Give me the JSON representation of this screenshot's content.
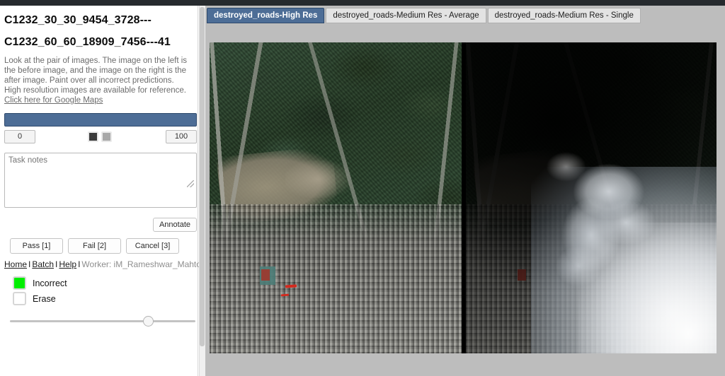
{
  "sidebar": {
    "title_line1": "C1232_30_30_9454_3728---",
    "title_line2": "C1232_60_60_18909_7456---41",
    "instructions": "Look at the pair of images. The image on the left is the before image, and the image on the right is the after image. Paint over all incorrect predictions. High resolution images are available for reference. ",
    "instructions_link": "Click here for Google Maps",
    "slider": {
      "min_label": "0",
      "max_label": "100"
    },
    "swatches": {
      "dark": "#3b3b3b",
      "light": "#a8a8a8"
    },
    "notes": {
      "placeholder": "Task notes",
      "value": ""
    },
    "annotate_label": "Annotate",
    "verdicts": [
      {
        "label": "Pass [1]"
      },
      {
        "label": "Fail [2]"
      },
      {
        "label": "Cancel [3]"
      }
    ],
    "links": {
      "home": "Home",
      "batch": "Batch",
      "help": "Help",
      "separator": "I",
      "worker": "Worker: iM_Rameshwar_Mahto"
    },
    "legend": [
      {
        "label": "Incorrect",
        "color": "#00ee00"
      },
      {
        "label": "Erase",
        "color": "#ffffff"
      }
    ],
    "brush_slider": {
      "value": 76
    }
  },
  "main": {
    "tabs": [
      {
        "label": "destroyed_roads-High Res",
        "active": true
      },
      {
        "label": "destroyed_roads-Medium Res - Average",
        "active": false
      },
      {
        "label": "destroyed_roads-Medium Res - Single",
        "active": false
      }
    ],
    "panes": {
      "before_name": "before-image",
      "after_name": "after-image"
    }
  },
  "colors": {
    "accent": "#4d6d96",
    "incorrect": "#00ee00",
    "topbar": "#262a2e"
  }
}
